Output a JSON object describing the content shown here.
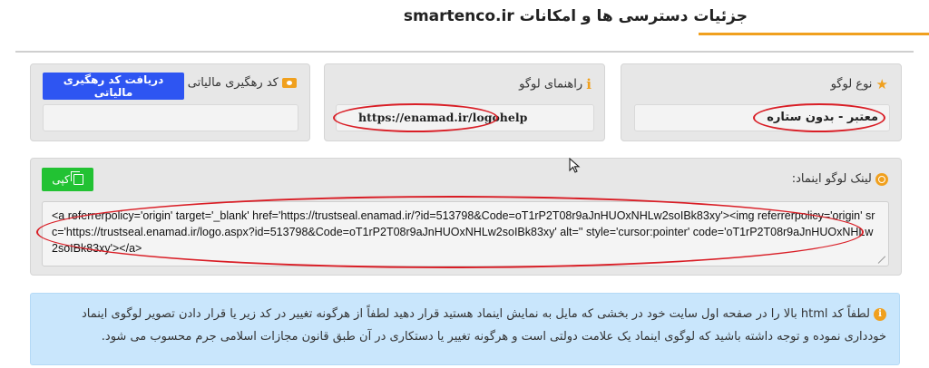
{
  "header": {
    "title": "جزئیات دسترسی ها و امکانات smartenco.ir"
  },
  "logo_type": {
    "label": "نوع لوگو",
    "value": "معتبر - بدون ستاره",
    "icon": "star-icon"
  },
  "logo_guide": {
    "label": "راهنمای لوگو",
    "value": "https://enamad.ir/logohelp",
    "icon": "info-icon"
  },
  "tax_tracking": {
    "label": "کد رهگیری مالیاتی",
    "button_label": "دریافت کد رهگیری مالیاتی",
    "value": "",
    "icon": "ticket-icon"
  },
  "logo_link": {
    "label": "لینک لوگو اینماد:",
    "copy_label": "کپی",
    "code": "<a referrerpolicy='origin' target='_blank' href='https://trustseal.enamad.ir/?id=513798&Code=oT1rP2T08r9aJnHUOxNHLw2soIBk83xy'><img referrerpolicy='origin' src='https://trustseal.enamad.ir/logo.aspx?id=513798&Code=oT1rP2T08r9aJnHUOxNHLw2soIBk83xy' alt='' style='cursor:pointer' code='oT1rP2T08r9aJnHUOxNHLw2soIBk83xy'></a>",
    "icon": "globe-icon"
  },
  "notice": {
    "text": "لطفاً کد html بالا را در صفحه اول سایت خود در بخشی که مایل به نمایش اینماد هستید قرار دهید لطفاً از هرگونه تغییر در کد زیر یا قرار دادن تصویر لوگوی اینماد خودداری نموده و توجه داشته باشید که لوگوی اینماد یک علامت دولتی است و هرگونه تغییر یا دستکاری در آن طبق قانون مجازات اسلامی جرم محسوب می شود.",
    "icon": "info-icon"
  },
  "colors": {
    "accent": "#f0a01e",
    "button_blue": "#2e55f2",
    "button_green": "#22c233",
    "annotation_red": "#d91e26",
    "notice_bg": "#c9e6fc",
    "card_bg": "#e7e7e7"
  }
}
